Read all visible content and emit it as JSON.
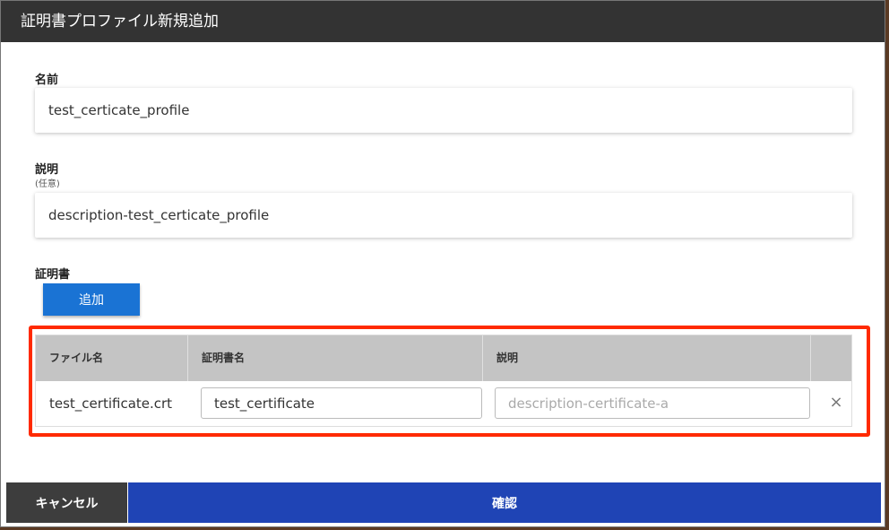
{
  "dialog": {
    "title": "証明書プロファイル新規追加"
  },
  "form": {
    "name": {
      "label": "名前",
      "value": "test_certicate_profile"
    },
    "description": {
      "label": "説明",
      "sublabel": "(任意)",
      "value": "description-test_certicate_profile"
    },
    "certificates": {
      "label": "証明書",
      "add_label": "追加"
    }
  },
  "table": {
    "columns": [
      "ファイル名",
      "証明書名",
      "説明",
      ""
    ],
    "rows": [
      {
        "file_name": "test_certificate.crt",
        "cert_name": "test_certificate",
        "description_placeholder": "description-certificate-a",
        "remove_icon": "×"
      }
    ]
  },
  "footer": {
    "cancel_label": "キャンセル",
    "confirm_label": "確認"
  },
  "colors": {
    "header_bg": "#333333",
    "add_button": "#1a73d4",
    "confirm_button": "#1f44b5",
    "cancel_button": "#3d3d3d",
    "highlight_border": "#ff2a00"
  }
}
